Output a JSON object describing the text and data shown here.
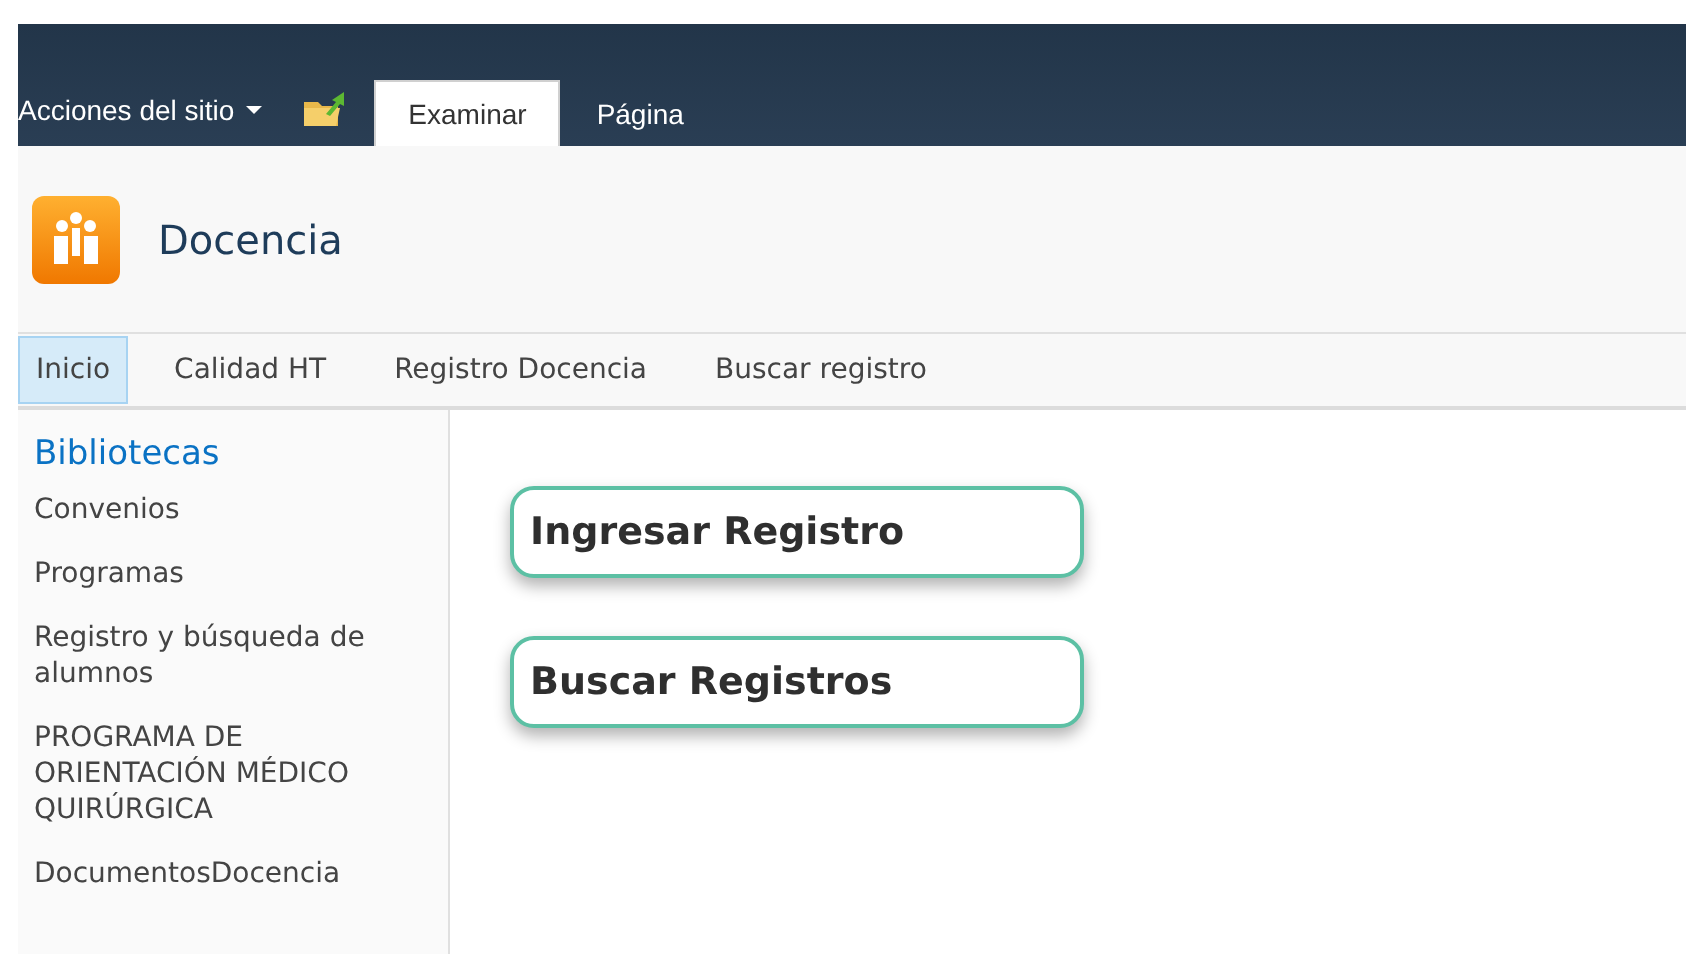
{
  "ribbon": {
    "site_actions": "Acciones del sitio",
    "tabs": [
      {
        "label": "Examinar",
        "selected": true
      },
      {
        "label": "Página",
        "selected": false
      }
    ]
  },
  "site": {
    "title": "Docencia"
  },
  "top_nav": [
    {
      "label": "Inicio",
      "selected": true
    },
    {
      "label": "Calidad HT",
      "selected": false
    },
    {
      "label": "Registro Docencia",
      "selected": false
    },
    {
      "label": "Buscar registro",
      "selected": false
    }
  ],
  "sidebar": {
    "heading": "Bibliotecas",
    "items": [
      "Convenios",
      "Programas",
      "Registro y búsqueda de alumnos",
      "PROGRAMA DE ORIENTACIÓN MÉDICO QUIRÚRGICA",
      "DocumentosDocencia"
    ]
  },
  "buttons": [
    "Ingresar Registro",
    "Buscar Registros"
  ]
}
